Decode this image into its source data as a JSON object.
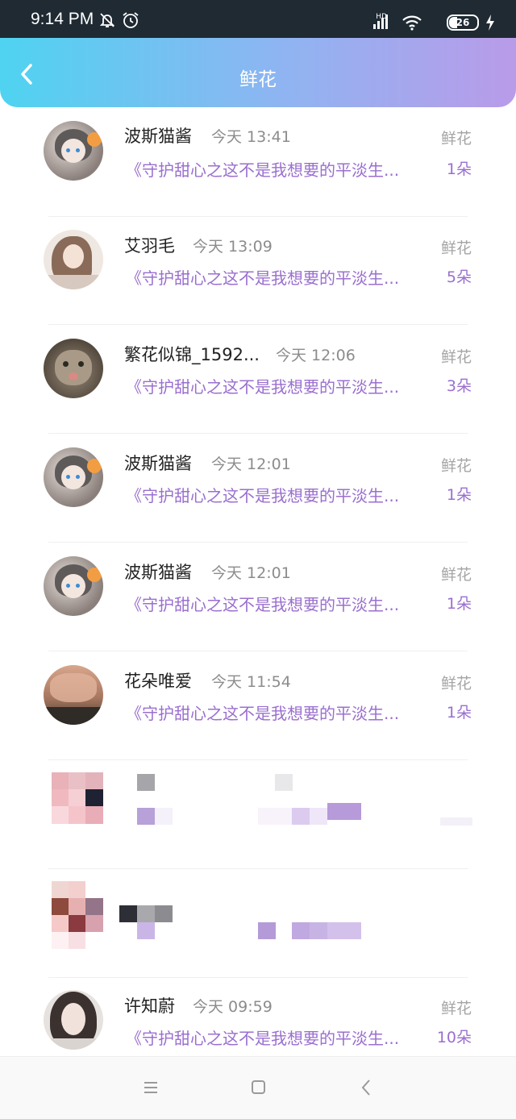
{
  "status_bar": {
    "time": "9:14 PM",
    "network": "HD",
    "battery": "26",
    "icons": [
      "bell-off-icon",
      "alarm-icon",
      "signal-icon",
      "wifi-icon",
      "battery-icon",
      "charging-icon"
    ]
  },
  "header": {
    "title": "鲜花",
    "gradient": [
      "#4fd3f1",
      "#b99be9"
    ]
  },
  "colors": {
    "accent_purple": "#9a6fcf",
    "muted_gray": "#a5a5a5"
  },
  "items": [
    {
      "name": "波斯猫酱",
      "time": "今天 13:41",
      "gift": "鲜花",
      "book": "《守护甜心之这不是我想要的平淡生...",
      "count": "1朵",
      "avatar": "anime-girl"
    },
    {
      "name": "艾羽毛",
      "time": "今天 13:09",
      "gift": "鲜花",
      "book": "《守护甜心之这不是我想要的平淡生...",
      "count": "5朵",
      "avatar": "girl-sketch"
    },
    {
      "name": "繁花似锦_1592...",
      "time": "今天 12:06",
      "gift": "鲜花",
      "book": "《守护甜心之这不是我想要的平淡生...",
      "count": "3朵",
      "avatar": "cat"
    },
    {
      "name": "波斯猫酱",
      "time": "今天 12:01",
      "gift": "鲜花",
      "book": "《守护甜心之这不是我想要的平淡生...",
      "count": "1朵",
      "avatar": "anime-girl"
    },
    {
      "name": "波斯猫酱",
      "time": "今天 12:01",
      "gift": "鲜花",
      "book": "《守护甜心之这不是我想要的平淡生...",
      "count": "1朵",
      "avatar": "anime-girl"
    },
    {
      "name": "花朵唯爱",
      "time": "今天 11:54",
      "gift": "鲜花",
      "book": "《守护甜心之这不是我想要的平淡生...",
      "count": "1朵",
      "avatar": "landscape"
    },
    {
      "pixelated": true
    },
    {
      "pixelated": true
    },
    {
      "name": "许知蔚",
      "time": "今天 09:59",
      "gift": "鲜花",
      "book": "《守护甜心之这不是我想要的平淡生...",
      "count": "10朵",
      "avatar": "woman-portrait"
    }
  ],
  "nav_bar": {
    "icons": [
      "menu-icon",
      "home-square-icon",
      "back-arrow-icon"
    ]
  }
}
